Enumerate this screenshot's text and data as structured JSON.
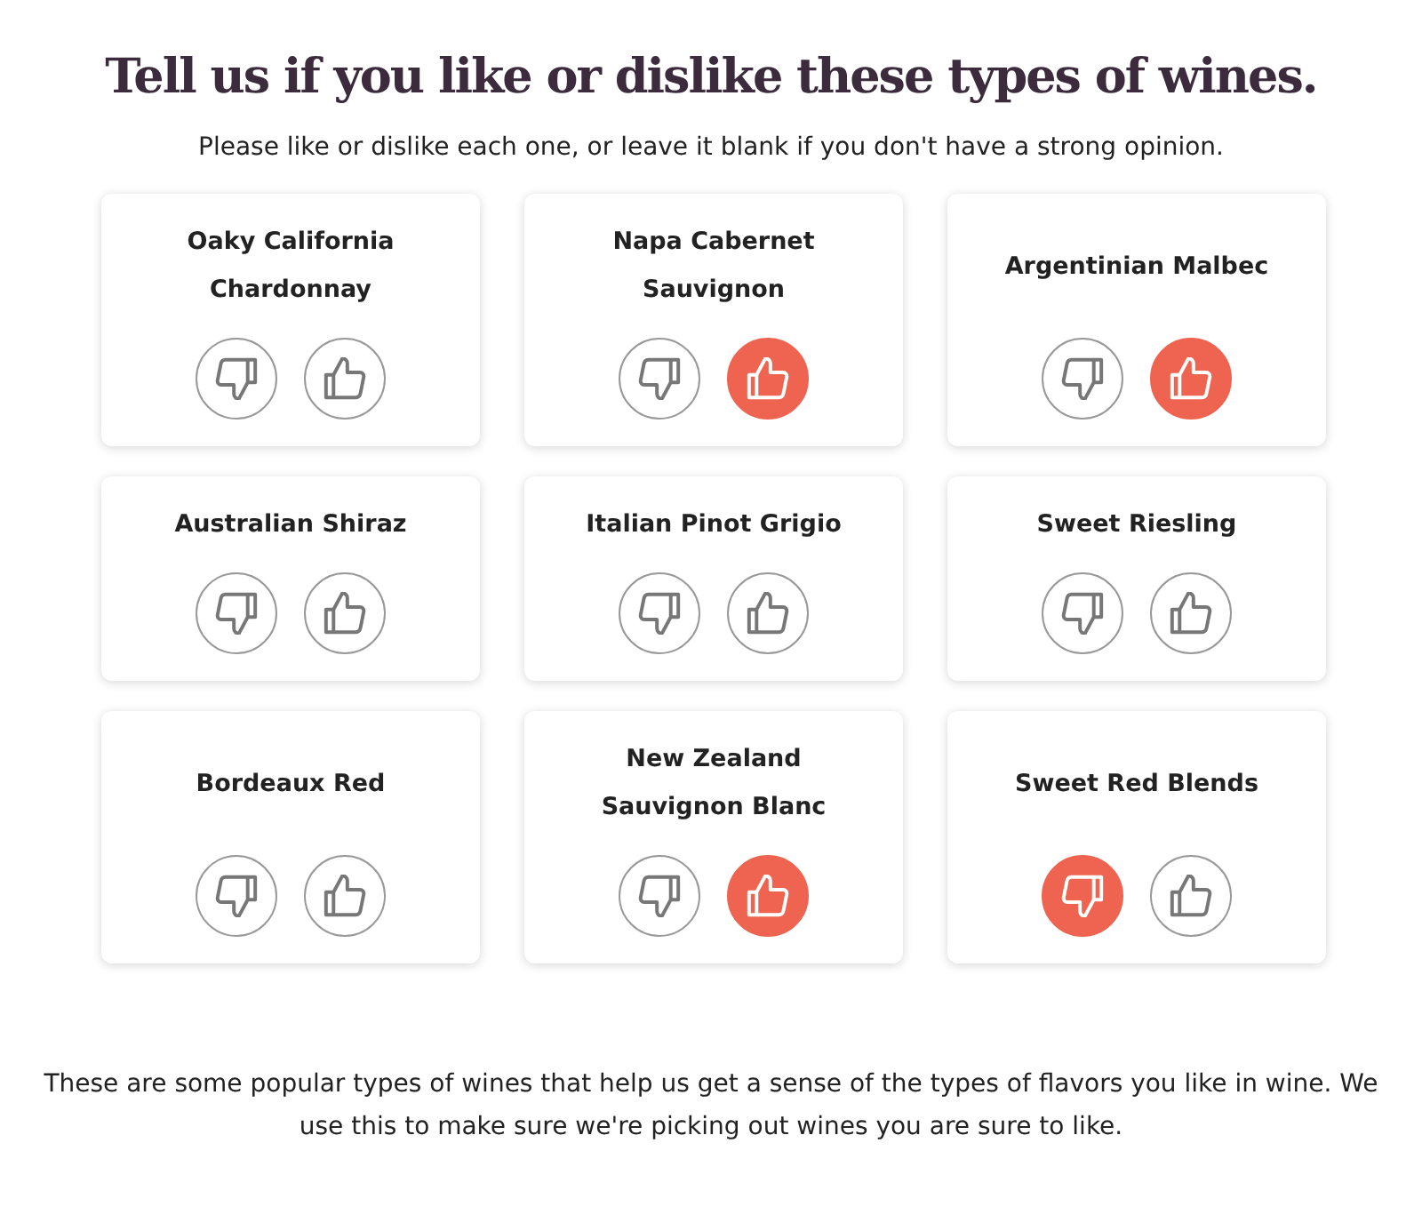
{
  "title": "Tell us if you like or dislike these types of wines.",
  "subtitle": "Please like or dislike each one, or leave it blank if you don't have a strong opinion.",
  "wines": [
    {
      "name": "Oaky California Chardonnay",
      "dislike": {
        "selected": false
      },
      "like": {
        "selected": false
      }
    },
    {
      "name": "Napa Cabernet Sauvignon",
      "dislike": {
        "selected": false
      },
      "like": {
        "selected": true
      }
    },
    {
      "name": "Argentinian Malbec",
      "dislike": {
        "selected": false
      },
      "like": {
        "selected": true
      }
    },
    {
      "name": "Australian Shiraz",
      "dislike": {
        "selected": false
      },
      "like": {
        "selected": false
      }
    },
    {
      "name": "Italian Pinot Grigio",
      "dislike": {
        "selected": false
      },
      "like": {
        "selected": false
      }
    },
    {
      "name": "Sweet Riesling",
      "dislike": {
        "selected": false
      },
      "like": {
        "selected": false
      }
    },
    {
      "name": "Bordeaux Red",
      "dislike": {
        "selected": false
      },
      "like": {
        "selected": false
      }
    },
    {
      "name": "New Zealand Sauvignon Blanc",
      "dislike": {
        "selected": false
      },
      "like": {
        "selected": true
      }
    },
    {
      "name": "Sweet Red Blends",
      "dislike": {
        "selected": true
      },
      "like": {
        "selected": false
      }
    }
  ],
  "footer": "These are some popular types of wines that help us get a sense of the types of flavors you like in wine. We use this to make sure we're picking out wines you are sure to like."
}
